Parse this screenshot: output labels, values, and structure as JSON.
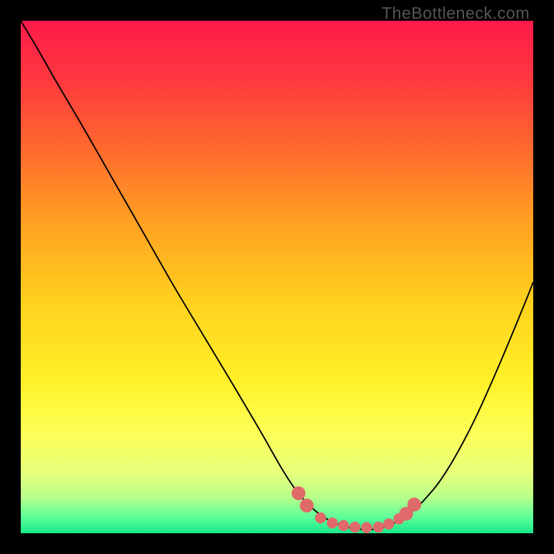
{
  "watermark": "TheBottleneck.com",
  "chart_data": {
    "type": "line",
    "title": "",
    "xlabel": "",
    "ylabel": "",
    "xlim": [
      0,
      100
    ],
    "ylim": [
      0,
      100
    ],
    "background_gradient": {
      "stops": [
        {
          "offset": 0.0,
          "color": "#ff1a4b"
        },
        {
          "offset": 0.12,
          "color": "#ff3a3e"
        },
        {
          "offset": 0.25,
          "color": "#ff6a2e"
        },
        {
          "offset": 0.4,
          "color": "#ffa321"
        },
        {
          "offset": 0.55,
          "color": "#ffd11e"
        },
        {
          "offset": 0.7,
          "color": "#fff028"
        },
        {
          "offset": 0.8,
          "color": "#fdff55"
        },
        {
          "offset": 0.88,
          "color": "#e8ff7a"
        },
        {
          "offset": 0.93,
          "color": "#b8ff8a"
        },
        {
          "offset": 0.97,
          "color": "#5aff9a"
        },
        {
          "offset": 1.0,
          "color": "#16e88a"
        }
      ]
    },
    "series": [
      {
        "name": "bottleneck-curve",
        "color": "#000000",
        "width": 2,
        "x": [
          0.0,
          3,
          7,
          12,
          18,
          24,
          30,
          36,
          42,
          47,
          51,
          54,
          57,
          60,
          63,
          66,
          69,
          72,
          75.5,
          79,
          83,
          88,
          93,
          98,
          100
        ],
        "y": [
          100,
          95,
          88,
          79.5,
          69,
          58.5,
          48,
          38,
          28,
          19.5,
          12.5,
          8,
          4.8,
          2.6,
          1.4,
          0.8,
          0.8,
          1.6,
          3.6,
          6.8,
          12,
          21,
          32,
          44,
          49
        ]
      }
    ],
    "highlights": {
      "name": "optimal-zone-markers",
      "color": "#e06a6a",
      "radius_small": 8,
      "radius_large": 10,
      "points": [
        {
          "x": 54.2,
          "y": 7.8
        },
        {
          "x": 55.8,
          "y": 5.4
        },
        {
          "x": 58.5,
          "y": 3.0
        },
        {
          "x": 60.8,
          "y": 2.0
        },
        {
          "x": 63.0,
          "y": 1.5
        },
        {
          "x": 65.2,
          "y": 1.2
        },
        {
          "x": 67.5,
          "y": 1.1
        },
        {
          "x": 69.8,
          "y": 1.2
        },
        {
          "x": 71.8,
          "y": 1.8
        },
        {
          "x": 73.8,
          "y": 2.8
        },
        {
          "x": 75.2,
          "y": 3.8
        },
        {
          "x": 76.8,
          "y": 5.6
        }
      ]
    }
  }
}
